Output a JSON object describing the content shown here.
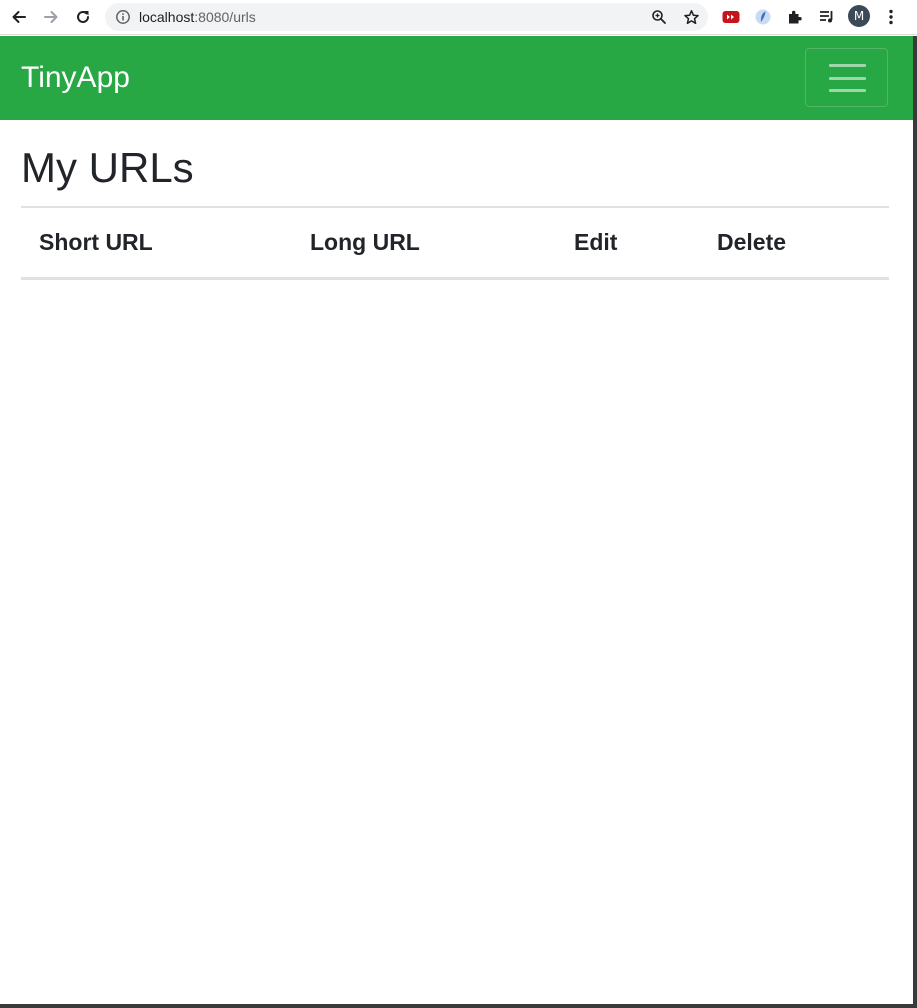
{
  "browser": {
    "url_host": "localhost",
    "url_rest": ":8080/urls",
    "profile_initial": "M"
  },
  "navbar": {
    "brand": "TinyApp"
  },
  "main": {
    "title": "My URLs",
    "table_headers": [
      "Short URL",
      "Long URL",
      "Edit",
      "Delete"
    ]
  },
  "colors": {
    "navbar_bg": "#28a745",
    "text": "#212529",
    "border": "#dee2e6"
  }
}
